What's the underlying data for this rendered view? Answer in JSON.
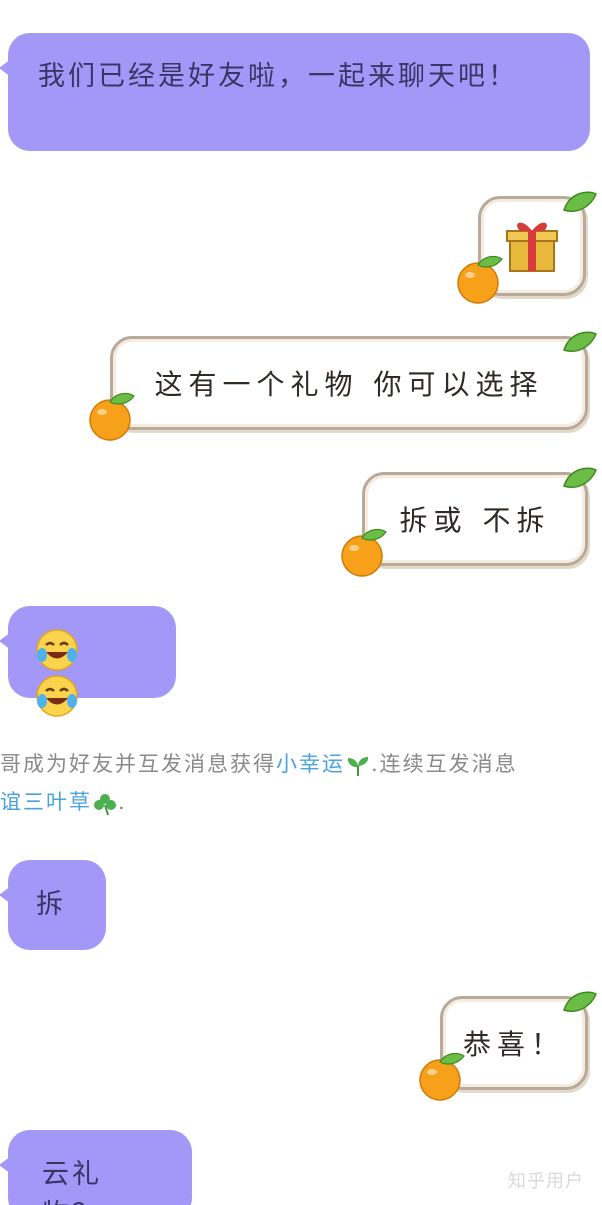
{
  "messages": {
    "m1": "我们已经是好友啦，一起来聊天吧！",
    "gift_alt": "gift",
    "m3": "这有一个礼物 你可以选择",
    "m4": "拆或 不拆",
    "m6": "拆",
    "m7": "恭喜！",
    "m8": "云礼物？"
  },
  "system": {
    "line1_prefix": "哥成为好友并互发消息获得",
    "line1_highlight": "小幸运",
    "line1_suffix": ".连续互发消息",
    "line2_highlight": "谊三叶草",
    "line2_suffix": "."
  },
  "watermark": "知乎用户"
}
